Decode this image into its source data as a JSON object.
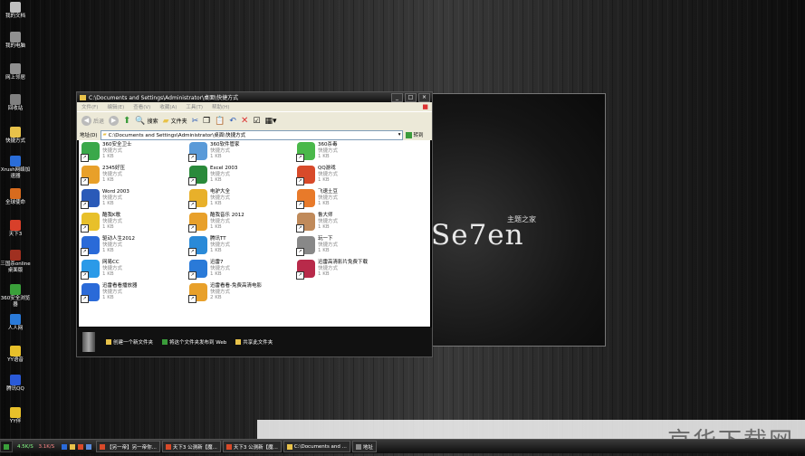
{
  "desktop_icons": [
    {
      "label": "我的文档",
      "icon": "my-documents-icon",
      "color": "#c0c0c0"
    },
    {
      "label": "我的电脑",
      "icon": "my-computer-icon",
      "color": "#909090"
    },
    {
      "label": "网上邻居",
      "icon": "network-icon",
      "color": "#909090"
    },
    {
      "label": "回收站",
      "icon": "recycle-bin-icon",
      "color": "#808080"
    },
    {
      "label": "快捷方式",
      "icon": "folder-icon",
      "color": "#e8c24a"
    },
    {
      "label": "Xrush网络加速器",
      "icon": "xrush-icon",
      "color": "#2a6dd8"
    },
    {
      "label": "全球使命",
      "icon": "game-icon",
      "color": "#d86b1e"
    },
    {
      "label": "天下3",
      "icon": "tx3-icon",
      "color": "#d8402a"
    },
    {
      "label": "三国杀online桌面版",
      "icon": "sgs-icon",
      "color": "#a03020"
    },
    {
      "label": "360安全浏览器",
      "icon": "browser-icon",
      "color": "#3aa03a"
    },
    {
      "label": "人人网",
      "icon": "renren-icon",
      "color": "#2a7ad8"
    },
    {
      "label": "YY语音",
      "icon": "yy-icon",
      "color": "#e8c02a"
    },
    {
      "label": "腾讯QQ",
      "icon": "qq-icon",
      "color": "#2a5ad8"
    },
    {
      "label": "YY伴",
      "icon": "yy-icon",
      "color": "#e8c02a"
    }
  ],
  "window": {
    "title": "C:\\Documents and Settings\\Administrator\\桌面\\快捷方式",
    "menu": [
      "文件(F)",
      "编辑(E)",
      "查看(V)",
      "收藏(A)",
      "工具(T)",
      "帮助(H)"
    ],
    "toolbar": {
      "back": "后退",
      "search": "搜索",
      "folders": "文件夹"
    },
    "address_label": "地址(D)",
    "address_value": "C:\\Documents and Settings\\Administrator\\桌面\\快捷方式",
    "go_label": "转到",
    "items": [
      {
        "name": "360安全卫士",
        "type": "快捷方式",
        "size": "1 KB",
        "color": "#3aa84a"
      },
      {
        "name": "360软件管家",
        "type": "快捷方式",
        "size": "1 KB",
        "color": "#5a9ad8"
      },
      {
        "name": "360杀毒",
        "type": "快捷方式",
        "size": "1 KB",
        "color": "#4ab84a"
      },
      {
        "name": "2345好压",
        "type": "快捷方式",
        "size": "1 KB",
        "color": "#e8a02a"
      },
      {
        "name": "Excel 2003",
        "type": "快捷方式",
        "size": "1 KB",
        "color": "#2a8a3a"
      },
      {
        "name": "QQ游戏",
        "type": "快捷方式",
        "size": "1 KB",
        "color": "#d84a2a"
      },
      {
        "name": "Word 2003",
        "type": "快捷方式",
        "size": "1 KB",
        "color": "#2a5ab8"
      },
      {
        "name": "电驴大全",
        "type": "快捷方式",
        "size": "1 KB",
        "color": "#e8b02a"
      },
      {
        "name": "飞速土豆",
        "type": "快捷方式",
        "size": "1 KB",
        "color": "#e87a2a"
      },
      {
        "name": "酷我K歌",
        "type": "快捷方式",
        "size": "1 KB",
        "color": "#e8c02a"
      },
      {
        "name": "酷我音乐 2012",
        "type": "快捷方式",
        "size": "1 KB",
        "color": "#e8a02a"
      },
      {
        "name": "鲁大师",
        "type": "快捷方式",
        "size": "1 KB",
        "color": "#c08a5a"
      },
      {
        "name": "驱动人生2012",
        "type": "快捷方式",
        "size": "1 KB",
        "color": "#2a6ad8"
      },
      {
        "name": "腾讯TT",
        "type": "快捷方式",
        "size": "1 KB",
        "color": "#2a8ad8"
      },
      {
        "name": "玩一下",
        "type": "快捷方式",
        "size": "1 KB",
        "color": "#888888"
      },
      {
        "name": "网易CC",
        "type": "快捷方式",
        "size": "1 KB",
        "color": "#2a9ae8"
      },
      {
        "name": "迅雷7",
        "type": "快捷方式",
        "size": "1 KB",
        "color": "#2a7ad8"
      },
      {
        "name": "迅雷高清影片免费下载",
        "type": "快捷方式",
        "size": "1 KB",
        "color": "#b82a4a"
      },
      {
        "name": "迅雷看看播放器",
        "type": "快捷方式",
        "size": "1 KB",
        "color": "#2a6ad8"
      },
      {
        "name": "迅雷看看-免费高清电影",
        "type": "快捷方式",
        "size": "2 KB",
        "color": "#e8a02a"
      }
    ],
    "tasks": [
      "创建一个新文件夹",
      "将这个文件夹发布到 Web",
      "共享此文件夹"
    ]
  },
  "wallpaper": {
    "logo": "Se7en",
    "logo_sub": "主题之家"
  },
  "taskbar": {
    "speed": "4.5K/S",
    "speed2": "3.1K/S",
    "items": [
      "【另一帝】另一帝你...",
      "天下3 公测新【魔...",
      "天下3 公测新【魔...",
      "C:\\Documents and ...",
      "地址"
    ]
  },
  "watermark": "京华下载网"
}
